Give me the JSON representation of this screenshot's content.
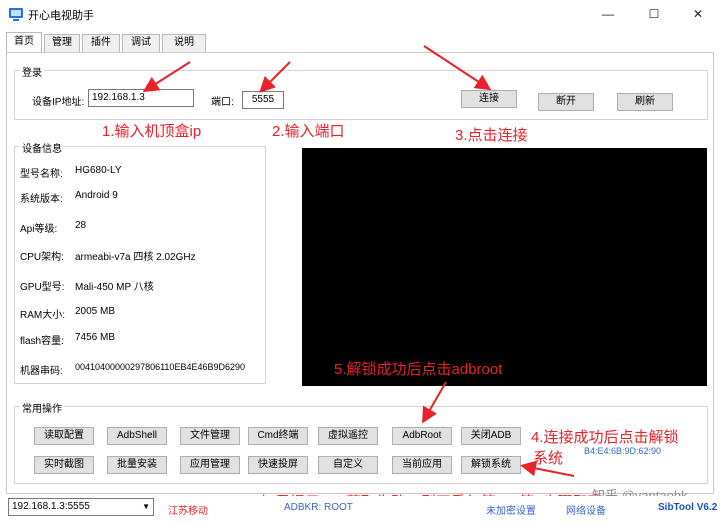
{
  "window": {
    "title": "开心电视助手",
    "minimize": "—",
    "maximize": "☐",
    "close": "✕"
  },
  "tabs": [
    "首页",
    "管理",
    "插件",
    "调试",
    "说明"
  ],
  "login": {
    "group_title": "登录",
    "ip_label": "设备IP地址:",
    "ip_value": "192.168.1.3",
    "port_label": "端口:",
    "port_value": "5555",
    "connect": "连接",
    "disconnect": "断开",
    "refresh": "刷新"
  },
  "device_info": {
    "group_title": "设备信息",
    "rows": [
      {
        "label": "型号名称:",
        "value": "HG680-LY"
      },
      {
        "label": "系统版本:",
        "value": "Android 9"
      },
      {
        "label": "Api等级:",
        "value": "28"
      },
      {
        "label": "CPU架构:",
        "value": "armeabi-v7a 四核 2.02GHz"
      },
      {
        "label": "GPU型号:",
        "value": "Mali-450 MP 八核"
      },
      {
        "label": "RAM大小:",
        "value": "2005 MB"
      },
      {
        "label": "flash容量:",
        "value": "7456 MB"
      },
      {
        "label": "机器串码:",
        "value": "00410400000297806110EB4E46B9D6290"
      }
    ]
  },
  "common_ops": {
    "group_title": "常用操作",
    "row1": [
      "读取配置",
      "AdbShell",
      "文件管理",
      "Cmd终端",
      "虚拟遥控",
      "AdbRoot",
      "关闭ADB"
    ],
    "row2": [
      "实时截图",
      "批量安装",
      "应用管理",
      "快速投屏",
      "自定义",
      "当前应用",
      "解锁系统"
    ]
  },
  "annotations": {
    "step1": "1.输入机顶盒ip",
    "step2": "2.输入端口",
    "step3": "3.点击连接",
    "step4_line1": "4.连接成功后点击解锁",
    "step4_line2": "系统",
    "step5": "5.解锁成功后点击adbroot",
    "bottom_note": "如果提示root获取失败，则再重复第4、第5步骤即可",
    "watermark": "知乎 @yantaohk",
    "mac": "B4:E4:6B:9D:62:90"
  },
  "status": {
    "device_select": "192.168.1.3:5555",
    "isp": "江苏移动",
    "adb_status": "ADBKR: ROOT",
    "mid": "未加密设置",
    "right": "网络设备",
    "version": "SibTool V6.2"
  },
  "colors": {
    "annotation": "#e8222a",
    "mac": "#3a63c9",
    "screen": "#000000"
  }
}
